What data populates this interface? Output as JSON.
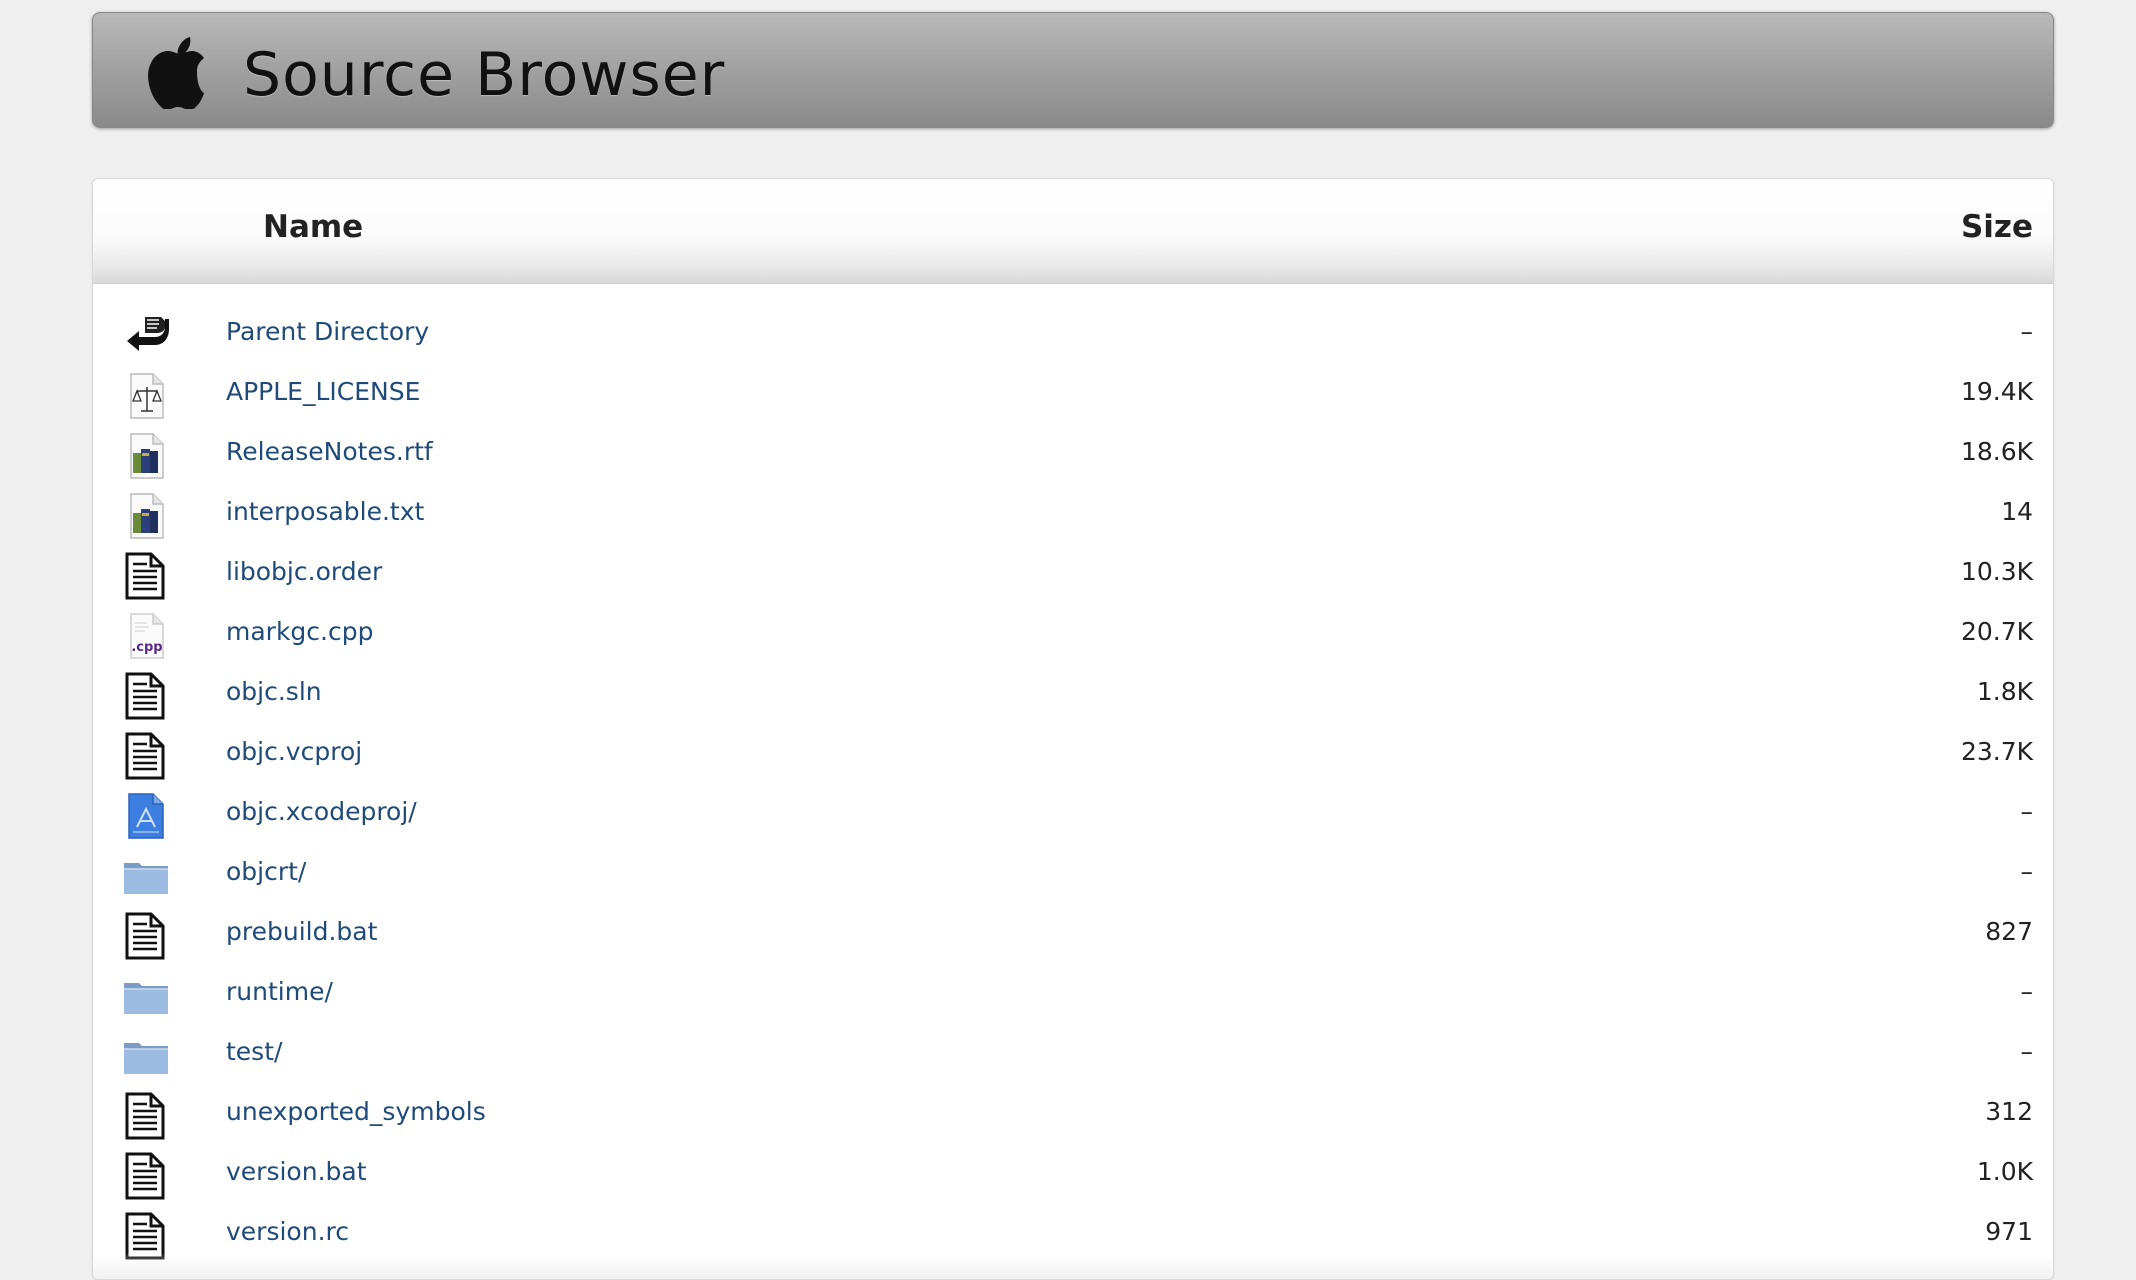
{
  "header": {
    "title": "Source Browser",
    "logo_icon": "apple-logo-icon"
  },
  "table": {
    "columns": {
      "name": "Name",
      "size": "Size"
    },
    "rows": [
      {
        "name": "Parent Directory",
        "size": "–",
        "icon": "parent-directory-icon"
      },
      {
        "name": "APPLE_LICENSE",
        "size": "19.4K",
        "icon": "license-icon"
      },
      {
        "name": "ReleaseNotes.rtf",
        "size": "18.6K",
        "icon": "books-icon"
      },
      {
        "name": "interposable.txt",
        "size": "14",
        "icon": "books-icon"
      },
      {
        "name": "libobjc.order",
        "size": "10.3K",
        "icon": "text-file-icon"
      },
      {
        "name": "markgc.cpp",
        "size": "20.7K",
        "icon": "cpp-file-icon",
        "icon_text": ".cpp"
      },
      {
        "name": "objc.sln",
        "size": "1.8K",
        "icon": "text-file-icon"
      },
      {
        "name": "objc.vcproj",
        "size": "23.7K",
        "icon": "text-file-icon"
      },
      {
        "name": "objc.xcodeproj/",
        "size": "–",
        "icon": "xcodeproj-icon"
      },
      {
        "name": "objcrt/",
        "size": "–",
        "icon": "folder-icon"
      },
      {
        "name": "prebuild.bat",
        "size": "827",
        "icon": "text-file-icon"
      },
      {
        "name": "runtime/",
        "size": "–",
        "icon": "folder-icon"
      },
      {
        "name": "test/",
        "size": "–",
        "icon": "folder-icon"
      },
      {
        "name": "unexported_symbols",
        "size": "312",
        "icon": "text-file-icon"
      },
      {
        "name": "version.bat",
        "size": "1.0K",
        "icon": "text-file-icon"
      },
      {
        "name": "version.rc",
        "size": "971",
        "icon": "text-file-icon"
      }
    ]
  },
  "colors": {
    "link": "#1f4a7a",
    "background": "#efefef",
    "folder": "#8fb0d6"
  }
}
